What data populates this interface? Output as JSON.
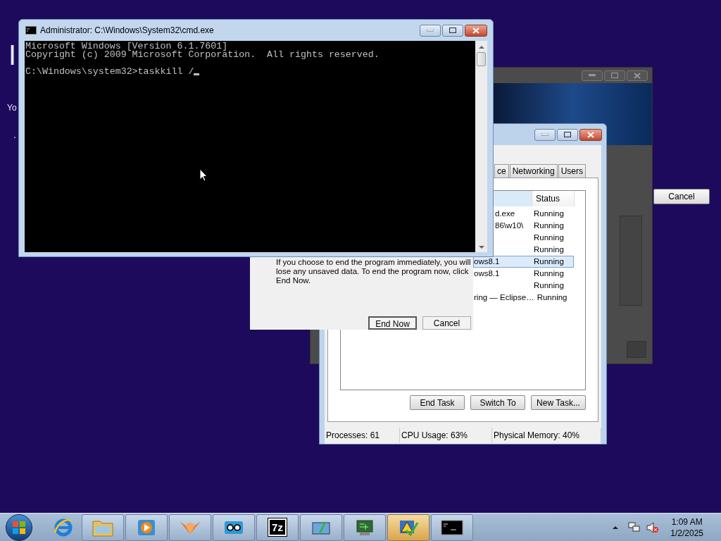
{
  "desktop": {
    "background_text": [
      "I",
      "Yo",
      "."
    ]
  },
  "setup_window": {
    "button": "Cancel"
  },
  "task_manager": {
    "tabs": [
      {
        "label": "ce",
        "selected": false
      },
      {
        "label": "Networking",
        "selected": false
      },
      {
        "label": "Users",
        "selected": false
      }
    ],
    "columns": [
      "Status"
    ],
    "rows": [
      {
        "name": "d.exe",
        "status": "Running",
        "selected": false
      },
      {
        "name": "86\\w10\\",
        "status": "Running",
        "selected": false
      },
      {
        "status": "Running",
        "selected": false
      },
      {
        "status": "Running",
        "selected": false
      },
      {
        "name": "ows8.1",
        "status": "Running",
        "selected": true
      },
      {
        "name": "ows8.1",
        "status": "Running",
        "selected": false
      },
      {
        "status": "Running",
        "selected": false
      },
      {
        "name": "ring — Eclipse…",
        "status": "Running",
        "selected": false
      }
    ],
    "buttons": [
      "End Task",
      "Switch To",
      "New Task..."
    ],
    "status_bar": [
      "Processes: 61",
      "CPU Usage: 63%",
      "Physical Memory: 40%"
    ]
  },
  "end_dialog": {
    "message": "If you choose to end the program immediately, you will lose any unsaved data. To end the program now, click End Now.",
    "buttons": [
      {
        "label": "End Now",
        "default": true
      },
      {
        "label": "Cancel",
        "default": false
      }
    ]
  },
  "cmd": {
    "title": "Administrator: C:\\Windows\\System32\\cmd.exe",
    "blocks": [
      [
        "Microsoft Windows [Version 6.1.7601]",
        "Copyright (c) 2009 Microsoft Corporation.  All rights reserved."
      ],
      [
        "C:\\Windows\\system32>taskkill /"
      ]
    ]
  },
  "taskbar": {
    "buttons": [
      {
        "kind": "folder",
        "selected": false
      },
      {
        "kind": "media",
        "selected": false
      },
      {
        "kind": "fox",
        "selected": false
      },
      {
        "kind": "glasses",
        "selected": false
      },
      {
        "kind": "archive",
        "label": "7z",
        "selected": false
      },
      {
        "kind": "monitor",
        "selected": false
      },
      {
        "kind": "chip",
        "selected": false
      },
      {
        "kind": "warning",
        "selected": true
      },
      {
        "kind": "console",
        "selected": false
      }
    ],
    "clock": {
      "time": "1:09 AM",
      "date": "1/2/2025"
    }
  }
}
